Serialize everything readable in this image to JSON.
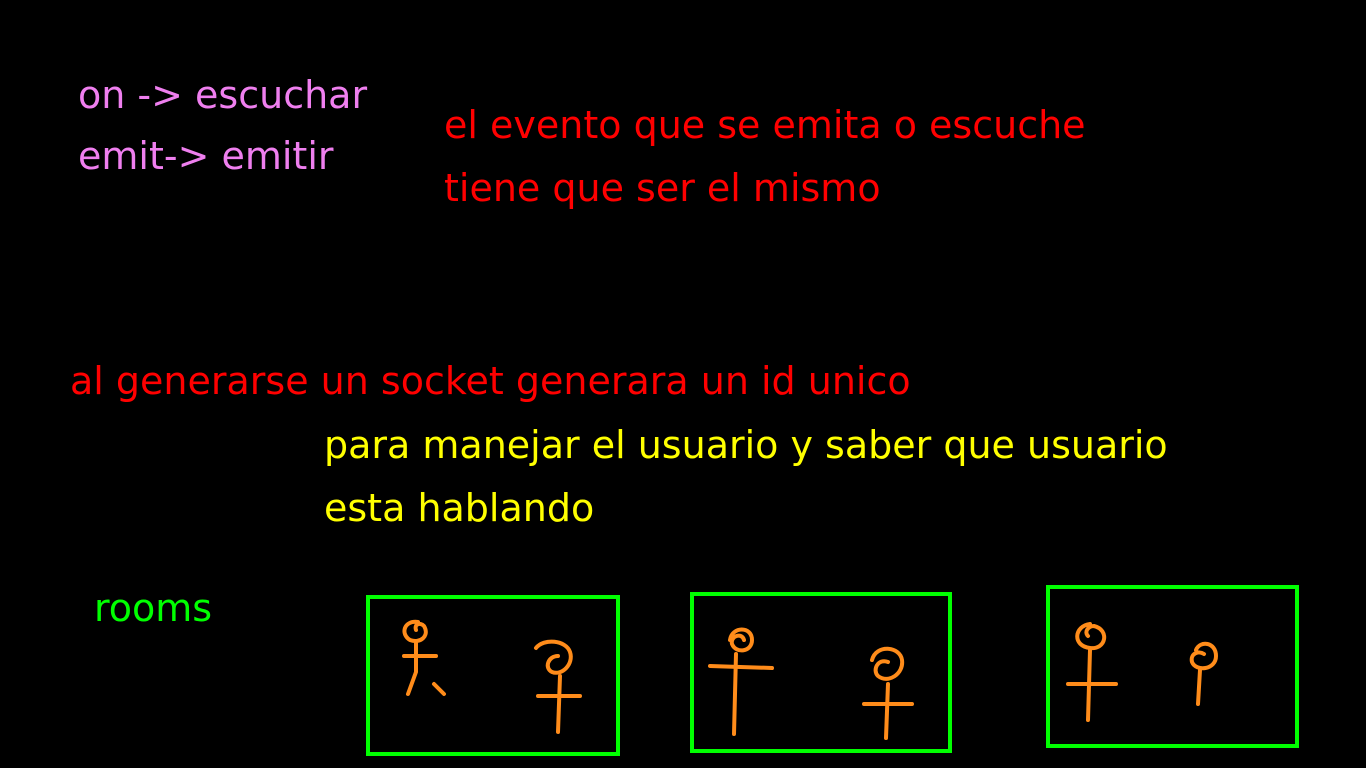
{
  "notes": {
    "on_line": "on -> escuchar",
    "emit_line": "emit-> emitir",
    "evento_line_1": "el evento que se emita o escuche",
    "evento_line_2": "tiene que ser el mismo",
    "socket_line": "al generarse un socket generara un id unico",
    "manejar_line_1": "para manejar el usuario y saber que usuario",
    "manejar_line_2": "esta hablando",
    "rooms_label": "rooms"
  },
  "rooms": [
    {
      "users": 2
    },
    {
      "users": 2
    },
    {
      "users": 2
    }
  ],
  "colors": {
    "background": "#000000",
    "pink": "#ef7fef",
    "red": "#ff0000",
    "yellow": "#ffff00",
    "green": "#00ff00",
    "orange": "#ff8c1a"
  }
}
